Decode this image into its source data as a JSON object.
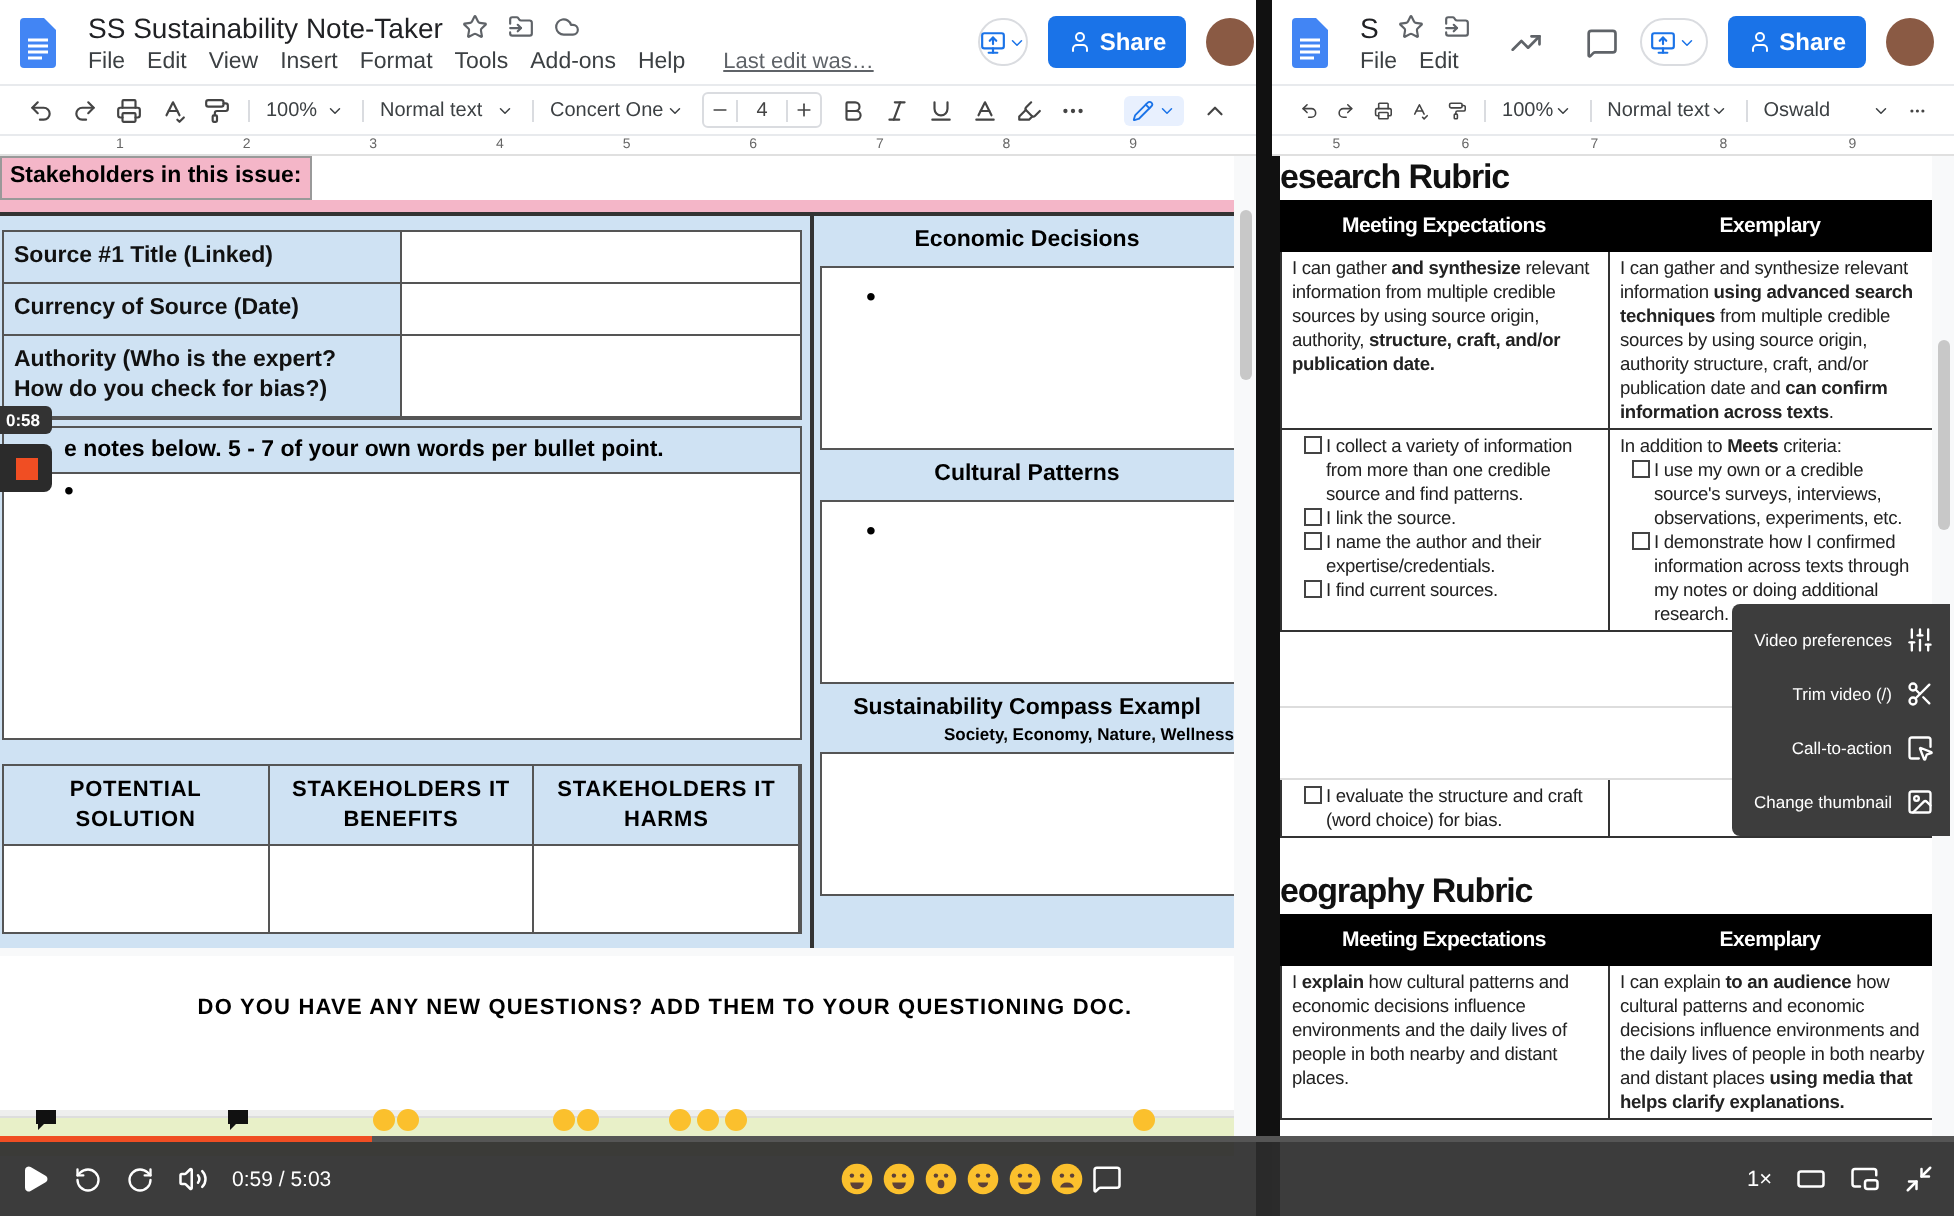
{
  "left_doc": {
    "title": "SS Sustainability Note-Taker",
    "menu": [
      "File",
      "Edit",
      "View",
      "Insert",
      "Format",
      "Tools",
      "Add-ons",
      "Help"
    ],
    "last_edit": "Last edit was…",
    "share": "Share",
    "toolbar": {
      "zoom": "100%",
      "style": "Normal text",
      "font": "Concert One",
      "size": "4"
    },
    "ruler": [
      "1",
      "2",
      "3",
      "4",
      "5",
      "6",
      "7",
      "8",
      "9"
    ],
    "stakeholders_label": "Stakeholders in this issue:",
    "source_rows": [
      {
        "label": "Source #1 Title (Linked)"
      },
      {
        "label": "Currency of Source (Date)"
      },
      {
        "label": "Authority (Who is the expert? How do you check for bias?)"
      }
    ],
    "notes_header": "e notes below. 5 - 7 of your own words per bullet point.",
    "notes_bullet": "•",
    "solution_columns": [
      "POTENTIAL SOLUTION",
      "STAKEHOLDERS IT BENEFITS",
      "STAKEHOLDERS IT HARMS"
    ],
    "side_panels": [
      {
        "title": "Economic Decisions",
        "bullet": "•"
      },
      {
        "title": "Cultural Patterns",
        "bullet": "•"
      },
      {
        "title": "Sustainability Compass Exampl",
        "subtitle": "Society, Economy, Nature, Wellness"
      }
    ],
    "question_banner": "DO YOU HAVE ANY NEW QUESTIONS? ADD THEM TO YOUR QUESTIONING DOC."
  },
  "right_doc": {
    "title": "S",
    "menu": [
      "File",
      "Edit"
    ],
    "share": "Share",
    "toolbar": {
      "zoom": "100%",
      "style": "Normal text",
      "font": "Oswald"
    },
    "ruler": [
      "5",
      "6",
      "7",
      "8",
      "9"
    ],
    "research_title": "esearch Rubric",
    "columns": [
      "Meeting Expectations",
      "Exemplary"
    ],
    "research_rows": [
      {
        "cells": [
          {
            "text": "I can gather **and synthesize** relevant information from multiple credible sources by using source origin, authority, **structure, craft, and/or publication date.**"
          },
          {
            "text": "I can gather and synthesize relevant information **using advanced search techniques** from multiple credible sources by using source origin, authority structure, craft, and/or publication date and **can confirm information across texts**."
          }
        ]
      },
      {
        "cells": [
          {
            "items": [
              {
                "text": "I collect a variety of information from more than one credible source and find patterns.",
                "checked": false
              },
              {
                "text": "I link the source.",
                "checked": false
              },
              {
                "text": "I name the author and their expertise/credentials.",
                "checked": false
              },
              {
                "text": "I find current sources.",
                "checked": false
              }
            ]
          },
          {
            "intro": "In addition to **Meets** criteria:",
            "items": [
              {
                "text": "I use my own or a credible source's surveys, interviews, observations, experiments, etc.",
                "checked": false
              },
              {
                "text": "I demonstrate how I confirmed information across texts through my notes or doing additional research.",
                "checked": false
              }
            ]
          }
        ]
      },
      {
        "cells": [
          {
            "items": [
              {
                "text": "I evaluate the structure and craft (word choice) for bias.",
                "checked": false
              }
            ]
          },
          {}
        ]
      }
    ],
    "geography_title": "eography Rubric",
    "geography_columns": [
      "Meeting Expectations",
      "Exemplary"
    ],
    "geography_rows": [
      {
        "cells": [
          {
            "text": "I **explain** how cultural patterns and economic decisions influence environments and the daily lives of people in both nearby and distant places."
          },
          {
            "text": "I can explain **to an audience** how cultural patterns and economic decisions influence environments and the daily lives of people in both nearby and distant places **using media that helps clarify explanations.**"
          }
        ]
      }
    ]
  },
  "recorder": {
    "timer": "0:58"
  },
  "video_menu": [
    {
      "label": "Video preferences",
      "kind": "preferences"
    },
    {
      "label": "Trim video (/)",
      "kind": "trim"
    },
    {
      "label": "Call-to-action",
      "kind": "cta"
    },
    {
      "label": "Change thumbnail",
      "kind": "thumbnail"
    }
  ],
  "player": {
    "time": "0:59 / 5:03",
    "speed": "1×",
    "level": 0.19
  }
}
